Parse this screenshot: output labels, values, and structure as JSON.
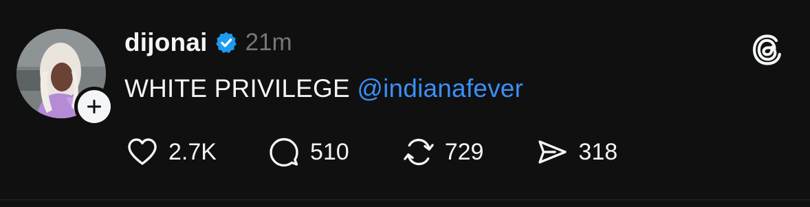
{
  "post": {
    "author": {
      "username": "dijonai",
      "verified": true,
      "avatar_icon": "profile-photo",
      "follow_icon": "plus-icon"
    },
    "timestamp": "21m",
    "text_plain": "WHITE PRIVILEGE ",
    "mention": "@indianafever",
    "actions": {
      "like": {
        "icon": "heart-icon",
        "count": "2.7K"
      },
      "reply": {
        "icon": "comment-bubble-icon",
        "count": "510"
      },
      "repost": {
        "icon": "repost-icon",
        "count": "729"
      },
      "share": {
        "icon": "send-icon",
        "count": "318"
      }
    }
  },
  "app": {
    "logo_icon": "threads-logo-icon"
  },
  "colors": {
    "background": "#101010",
    "text_primary": "#f3f5f7",
    "text_secondary": "#777777",
    "mention": "#3b8ff5",
    "verified": "#1d9bf0"
  }
}
